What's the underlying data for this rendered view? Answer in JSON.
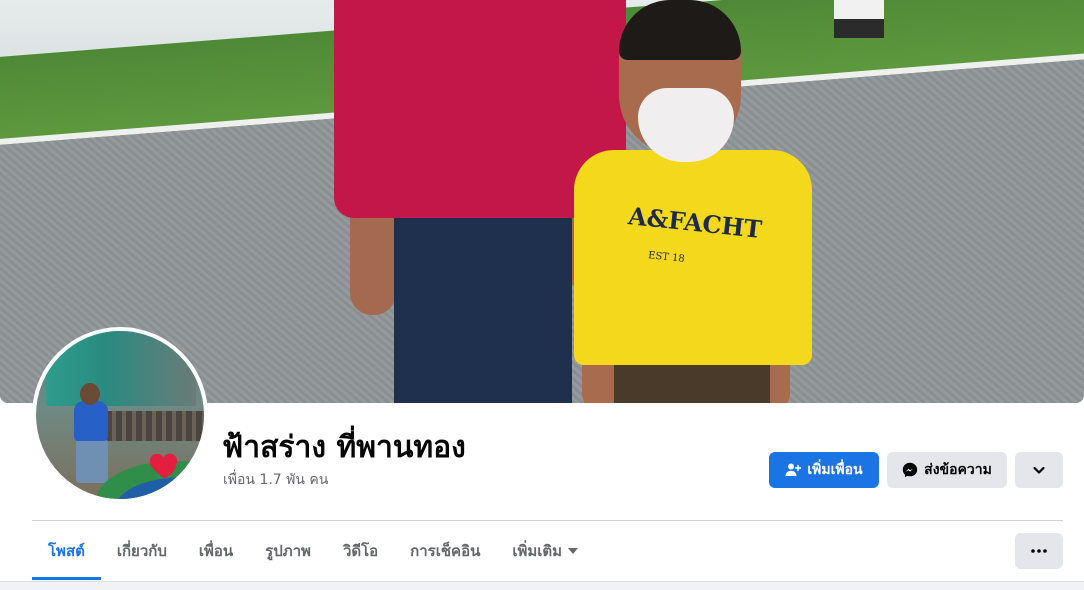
{
  "profile": {
    "name": "ฟ้าสร่าง ที่พานทอง",
    "friends_text": "เพื่อน 1.7 พัน คน"
  },
  "cover": {
    "shirt_logo": "A&FACHT",
    "shirt_logo_sub": "EST 18"
  },
  "actions": {
    "add_friend_label": "เพิ่มเพื่อน",
    "message_label": "ส่งข้อความ"
  },
  "tabs": [
    {
      "label": "โพสต์",
      "active": true
    },
    {
      "label": "เกี่ยวกับ",
      "active": false
    },
    {
      "label": "เพื่อน",
      "active": false
    },
    {
      "label": "รูปภาพ",
      "active": false
    },
    {
      "label": "วิดีโอ",
      "active": false
    },
    {
      "label": "การเช็คอิน",
      "active": false
    },
    {
      "label": "เพิ่มเติม",
      "active": false
    }
  ],
  "icons": {
    "add_friend": "person-plus-icon",
    "message": "messenger-icon",
    "dropdown": "chevron-down-icon",
    "more": "ellipsis-icon",
    "tab_more": "caret-down-icon"
  },
  "colors": {
    "accent": "#1b74e4",
    "button_secondary": "#e4e6eb",
    "text_primary": "#050505",
    "text_secondary": "#65676b"
  }
}
